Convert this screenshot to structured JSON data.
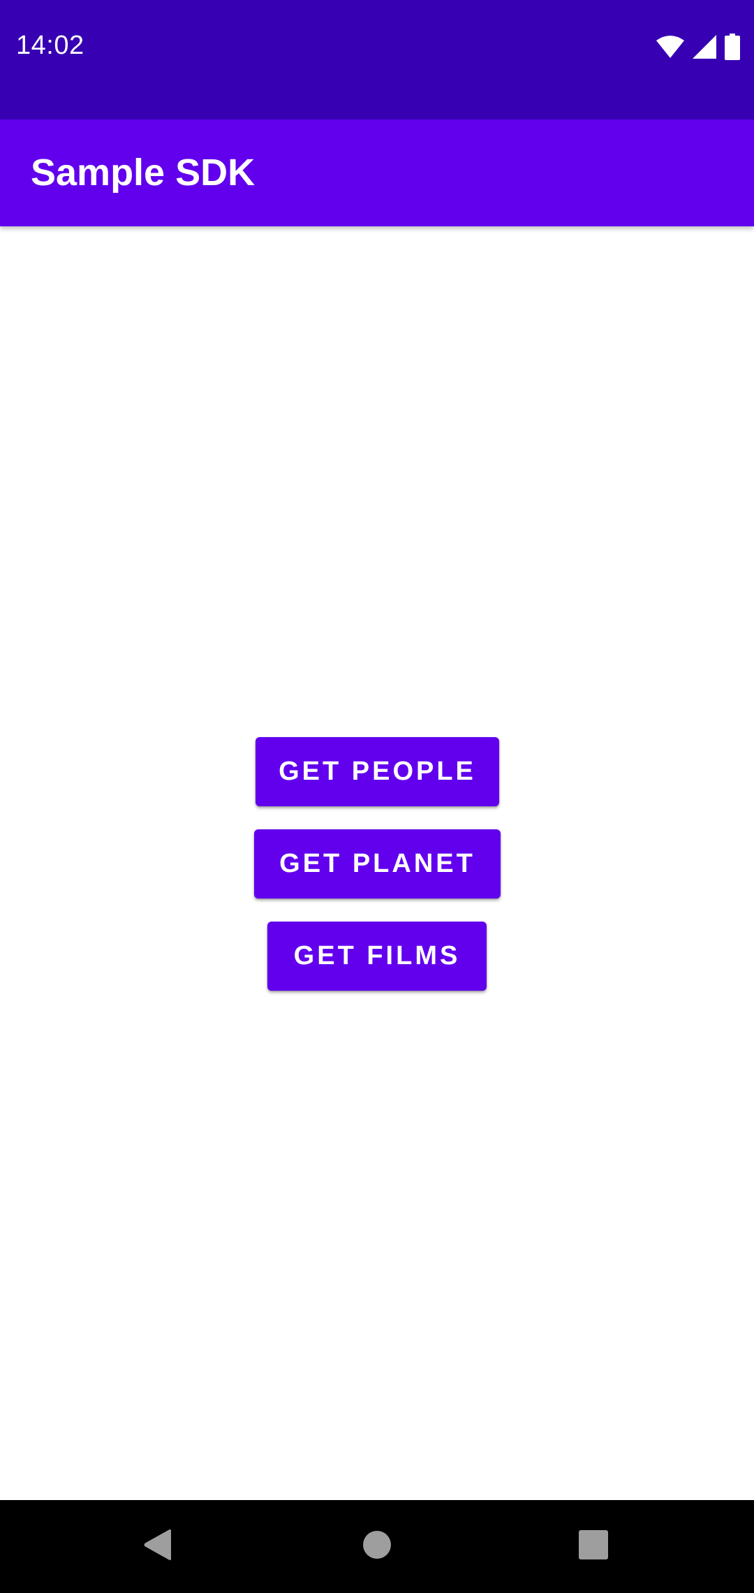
{
  "status_bar": {
    "time": "14:02",
    "icons": [
      "wifi-icon",
      "cell-signal-icon",
      "battery-icon"
    ]
  },
  "app_bar": {
    "title": "Sample SDK"
  },
  "main": {
    "buttons": [
      {
        "label": "GET PEOPLE"
      },
      {
        "label": "GET PLANET"
      },
      {
        "label": "GET FILMS"
      }
    ]
  },
  "nav_bar": {
    "icons": [
      "back-icon",
      "home-icon",
      "recents-icon"
    ]
  },
  "colors": {
    "status_bar": "#3700B3",
    "primary": "#6200EE",
    "background": "#FFFFFF",
    "nav_bar": "#000000",
    "nav_icon": "#9E9E9E"
  }
}
